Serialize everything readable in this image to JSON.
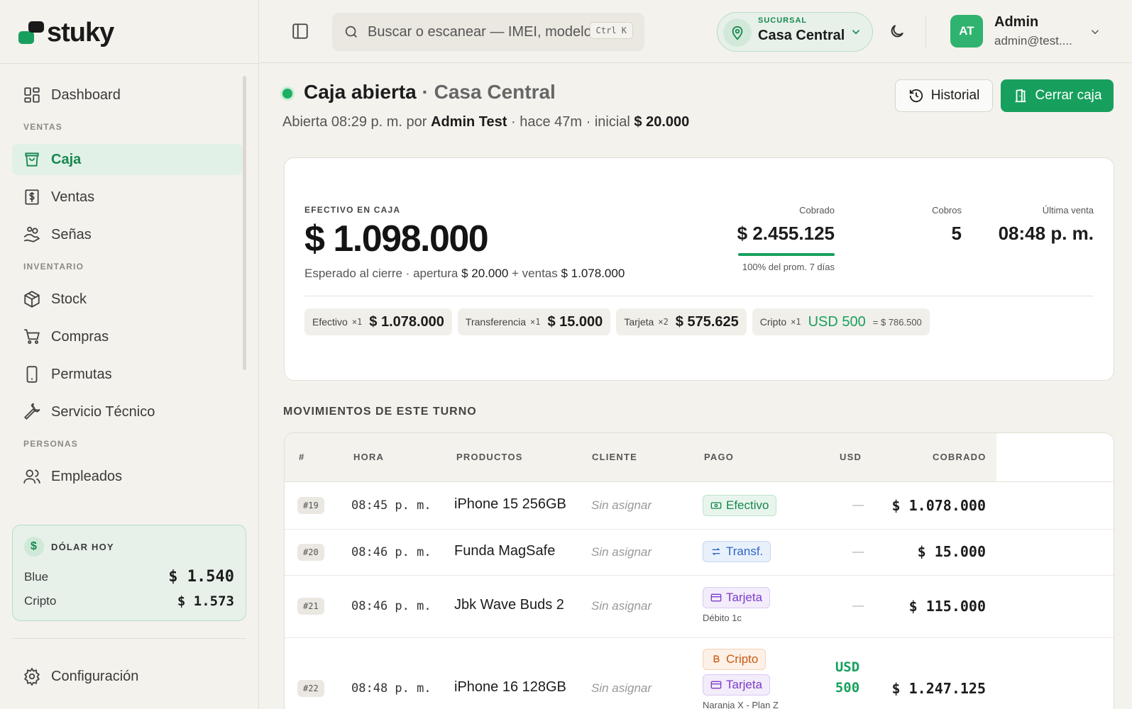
{
  "brand": {
    "name": "stuky"
  },
  "sidebar": {
    "items": [
      {
        "label": "Dashboard"
      },
      {
        "label": "Caja"
      },
      {
        "label": "Ventas"
      },
      {
        "label": "Señas"
      },
      {
        "label": "Stock"
      },
      {
        "label": "Compras"
      },
      {
        "label": "Permutas"
      },
      {
        "label": "Servicio Técnico"
      },
      {
        "label": "Empleados"
      }
    ],
    "sections": {
      "ventas": "VENTAS",
      "inventario": "INVENTARIO",
      "personas": "PERSONAS"
    },
    "dolar": {
      "title": "DÓLAR HOY",
      "icon": "$",
      "rows": [
        {
          "label": "Blue",
          "value": "$ 1.540"
        },
        {
          "label": "Cripto",
          "value": "$ 1.573"
        }
      ]
    },
    "config_label": "Configuración"
  },
  "topbar": {
    "search_placeholder": "Buscar o escanear — IMEI, modelo, cliente...",
    "shortcut": "Ctrl K",
    "sucursal_label": "SUCURSAL",
    "sucursal_name": "Casa Central",
    "user_initials": "AT",
    "user_name": "Admin",
    "user_email": "admin@test...."
  },
  "header": {
    "title": "Caja abierta",
    "branch": "· Casa Central",
    "opened_prefix": "Abierta 08:29 p. m. por ",
    "opened_by": "Admin Test",
    "opened_mid": " · hace 47m · inicial ",
    "opened_initial": "$ 20.000",
    "history_label": "Historial",
    "close_label": "Cerrar caja"
  },
  "summary": {
    "cash_label": "EFECTIVO EN CAJA",
    "cash_amount": "$ 1.098.000",
    "expected_prefix": "Esperado al cierre · apertura ",
    "expected_open": "$ 20.000",
    "expected_mid": " + ventas ",
    "expected_sales": "$ 1.078.000",
    "cobrado_label": "Cobrado",
    "cobrado_value": "$ 2.455.125",
    "cobrado_progress_pct": 100,
    "cobrado_note": "100% del prom. 7 días",
    "cobros_label": "Cobros",
    "cobros_value": "5",
    "last_label": "Última venta",
    "last_value": "08:48 p. m.",
    "chips": [
      {
        "name": "Efectivo",
        "count": "×1",
        "amount": "$ 1.078.000",
        "equiv": ""
      },
      {
        "name": "Transferencia",
        "count": "×1",
        "amount": "$ 15.000",
        "equiv": ""
      },
      {
        "name": "Tarjeta",
        "count": "×2",
        "amount": "$ 575.625",
        "equiv": ""
      },
      {
        "name": "Cripto",
        "count": "×1",
        "amount": "USD 500",
        "equiv": "= $ 786.500"
      }
    ]
  },
  "movements": {
    "title": "MOVIMIENTOS DE ESTE TURNO",
    "columns": {
      "id": "#",
      "hora": "HORA",
      "productos": "PRODUCTOS",
      "cliente": "CLIENTE",
      "pago": "PAGO",
      "usd": "USD",
      "cobrado": "COBRADO"
    },
    "rows": [
      {
        "id": "#19",
        "hora": "08:45 p. m.",
        "producto": "iPhone 15 256GB",
        "cliente": "Sin asignar",
        "pagos": [
          {
            "label": "Efectivo",
            "icon": "cash-icon"
          }
        ],
        "pago_sub": "",
        "usd": "—",
        "cobrado": "$ 1.078.000"
      },
      {
        "id": "#20",
        "hora": "08:46 p. m.",
        "producto": "Funda MagSafe",
        "cliente": "Sin asignar",
        "pagos": [
          {
            "label": "Transf.",
            "icon": "transfer-icon"
          }
        ],
        "pago_sub": "",
        "usd": "—",
        "cobrado": "$ 15.000"
      },
      {
        "id": "#21",
        "hora": "08:46 p. m.",
        "producto": "Jbk Wave Buds 2",
        "cliente": "Sin asignar",
        "pagos": [
          {
            "label": "Tarjeta",
            "icon": "card-icon"
          }
        ],
        "pago_sub": "Débito 1c",
        "usd": "—",
        "cobrado": "$ 115.000"
      },
      {
        "id": "#22",
        "hora": "08:48 p. m.",
        "producto": "iPhone 16 128GB",
        "cliente": "Sin asignar",
        "pagos": [
          {
            "label": "Cripto",
            "icon": "bitcoin-icon"
          },
          {
            "label": "Tarjeta",
            "icon": "card-icon"
          }
        ],
        "pago_sub": "Naranja X - Plan Z",
        "usd_line1": "USD",
        "usd_line2": "500",
        "cobrado": "$ 1.247.125"
      }
    ]
  },
  "colors": {
    "accent": "#17a05d",
    "background": "#f4f2ed",
    "transfer": "#2f66c5",
    "card": "#7b3cc9",
    "crypto": "#c85a12"
  }
}
